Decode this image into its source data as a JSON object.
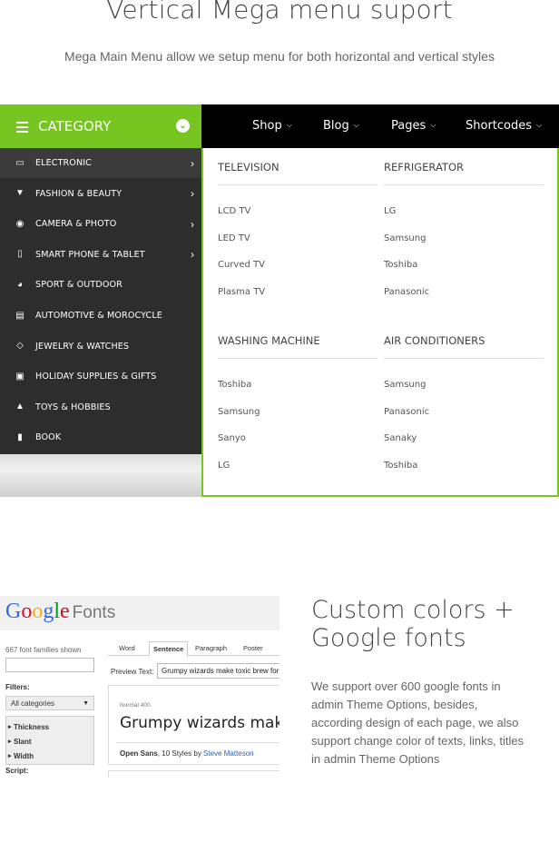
{
  "hero": {
    "title": "Vertical Mega menu suport",
    "subtitle": "Mega Main Menu allow we setup menu for both horizontal and vertical styles"
  },
  "colors": {
    "accent": "#77c520",
    "sidebar_bg": "#2d2d2d",
    "topnav_bg": "#000000"
  },
  "category": {
    "title": "CATEGORY",
    "toggle_icon": "chevron-down-icon"
  },
  "topnav": [
    {
      "label": "Shop"
    },
    {
      "label": "Blog"
    },
    {
      "label": "Pages"
    },
    {
      "label": "Shortcodes"
    }
  ],
  "sidebar": {
    "items": [
      {
        "label": "ELECTRONIC",
        "icon": "laptop-icon",
        "has_submenu": true,
        "active": true
      },
      {
        "label": "FASHION & BEAUTY",
        "icon": "tshirt-icon",
        "has_submenu": true
      },
      {
        "label": "CAMERA & PHOTO",
        "icon": "camera-icon",
        "has_submenu": true
      },
      {
        "label": "SMART PHONE & TABLET",
        "icon": "tablet-icon",
        "has_submenu": true
      },
      {
        "label": "SPORT & OUTDOOR",
        "icon": "globe-icon",
        "has_submenu": false
      },
      {
        "label": "AUTOMOTIVE & MOROCYCLE",
        "icon": "car-icon",
        "has_submenu": false
      },
      {
        "label": "JEWELRY & WATCHES",
        "icon": "diamond-icon",
        "has_submenu": false
      },
      {
        "label": "HOLIDAY SUPPLIES & GIFTS",
        "icon": "gift-icon",
        "has_submenu": false
      },
      {
        "label": "TOYS & HOBBIES",
        "icon": "toy-icon",
        "has_submenu": false
      },
      {
        "label": "BOOK",
        "icon": "book-icon",
        "has_submenu": false
      }
    ]
  },
  "mega": {
    "columns": [
      {
        "heading": "TELEVISION",
        "links": [
          "LCD TV",
          "LED TV",
          "Curved TV",
          "Plasma TV"
        ]
      },
      {
        "heading": "REFRIGERATOR",
        "links": [
          "LG",
          "Samsung",
          "Toshiba",
          "Panasonic"
        ]
      },
      {
        "heading": "WASHING MACHINE",
        "links": [
          "Toshiba",
          "Samsung",
          "Sanyo",
          "LG"
        ]
      },
      {
        "heading": "AIR CONDITIONERS",
        "links": [
          "Samsung",
          "Panasonic",
          "Sanaky",
          "Toshiba"
        ]
      }
    ]
  },
  "google_fonts": {
    "logo_google": "Google",
    "logo_fonts": "Fonts",
    "count": "667 font families shown",
    "filters_label": "Filters:",
    "category_select": "All categories",
    "properties": [
      "Thickness",
      "Slant",
      "Width"
    ],
    "script_label": "Script:",
    "tabs": [
      "Word",
      "Sentence",
      "Paragraph",
      "Poster"
    ],
    "active_tab": "Sentence",
    "preview_label": "Preview Text:",
    "preview_value": "Grumpy wizards make toxic brew for th",
    "normal_label": "Normal 400",
    "sample_text": "Grumpy wizards make",
    "font_family": "Open Sans",
    "styles_text": ", 10 Styles by ",
    "author": "Steve Matteson"
  },
  "custom": {
    "title_line1": "Custom colors +",
    "title_line2": "Google fonts",
    "description": "We support over 600 google fonts in admin Theme Options, besides, according design of each page, we also support change color of texts, links, titles  in admin Theme Options"
  }
}
